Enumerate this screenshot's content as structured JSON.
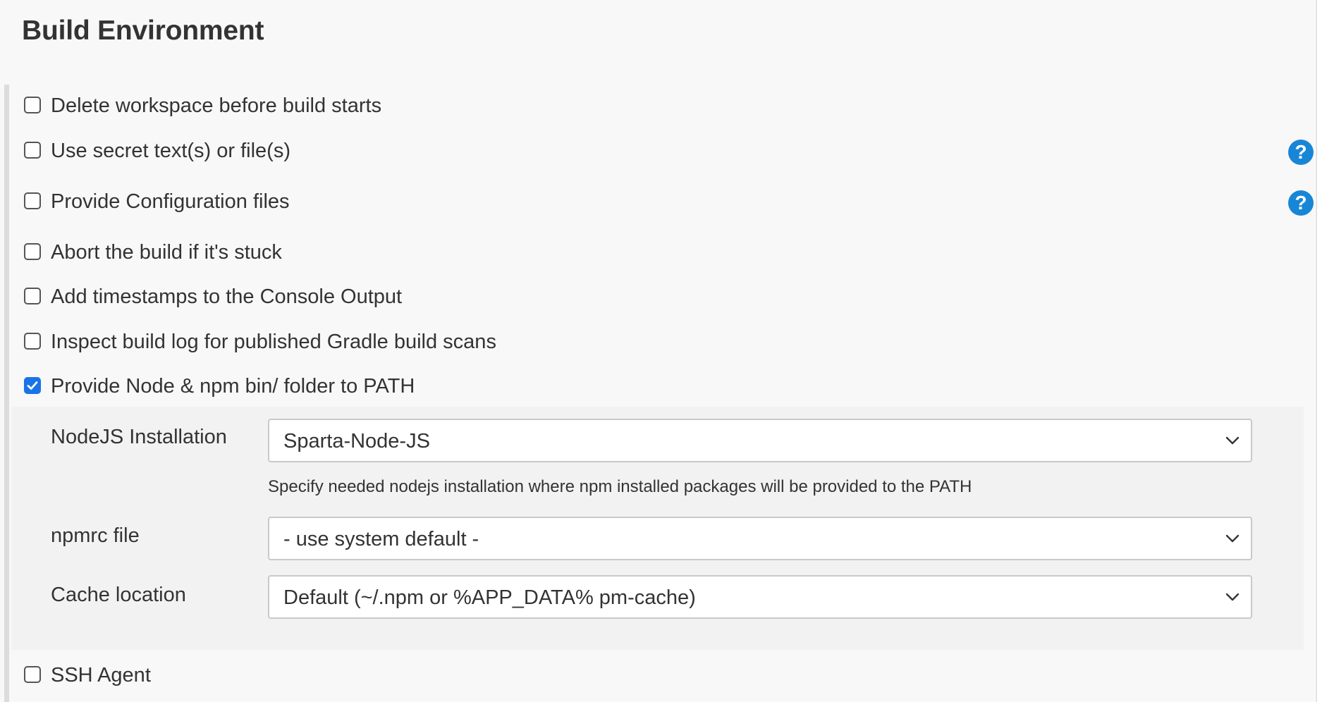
{
  "section": {
    "title": "Build Environment"
  },
  "options": [
    {
      "label": "Delete workspace before build starts",
      "checked": false,
      "help": false
    },
    {
      "label": "Use secret text(s) or file(s)",
      "checked": false,
      "help": true
    },
    {
      "label": "Provide Configuration files",
      "checked": false,
      "help": true
    },
    {
      "label": "Abort the build if it's stuck",
      "checked": false,
      "help": false
    },
    {
      "label": "Add timestamps to the Console Output",
      "checked": false,
      "help": false
    },
    {
      "label": "Inspect build log for published Gradle build scans",
      "checked": false,
      "help": false
    },
    {
      "label": "Provide Node & npm bin/ folder to PATH",
      "checked": true,
      "help": false
    }
  ],
  "node_config": {
    "nodejs_installation": {
      "label": "NodeJS Installation",
      "value": "Sparta-Node-JS",
      "hint": "Specify needed nodejs installation where npm installed packages will be provided to the PATH"
    },
    "npmrc_file": {
      "label": "npmrc file",
      "value": "- use system default -"
    },
    "cache_location": {
      "label": "Cache location",
      "value": "Default (~/.npm or %APP_DATA% pm-cache)"
    }
  },
  "ssh_agent": {
    "label": "SSH Agent",
    "checked": false
  },
  "help_icon_glyph": "?",
  "colors": {
    "accent": "#1a73e8",
    "help": "#1886d6",
    "panel_bg": "#f8f8f8",
    "subpanel_bg": "#f2f2f2",
    "text": "#333333"
  }
}
